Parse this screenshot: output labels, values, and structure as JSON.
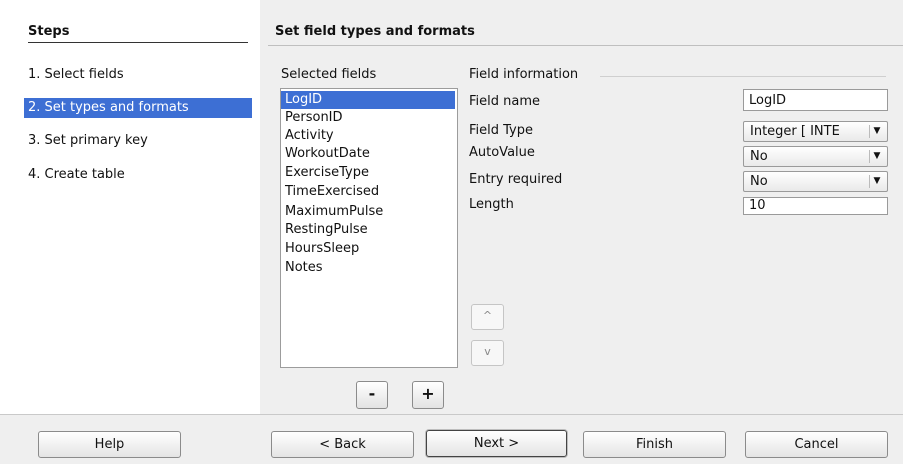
{
  "steps_pane": {
    "title": "Steps",
    "items": [
      {
        "label": "1. Select fields",
        "active": false
      },
      {
        "label": "2. Set types and formats",
        "active": true
      },
      {
        "label": "3. Set primary key",
        "active": false
      },
      {
        "label": "4. Create table",
        "active": false
      }
    ]
  },
  "page": {
    "title": "Set field types and formats"
  },
  "selected_fields": {
    "label": "Selected fields",
    "items": [
      "LogID",
      "PersonID",
      "Activity",
      "WorkoutDate",
      "ExerciseType",
      "TimeExercised",
      "MaximumPulse",
      "RestingPulse",
      "HoursSleep",
      "Notes"
    ],
    "selected": "LogID",
    "remove_label": "-",
    "add_label": "+"
  },
  "field_information": {
    "label": "Field information",
    "field_name": {
      "label": "Field name",
      "value": "LogID"
    },
    "field_type": {
      "label": "Field Type",
      "value": "Integer [ INTE"
    },
    "auto_value": {
      "label": "AutoValue",
      "value": "No"
    },
    "entry_required": {
      "label": "Entry required",
      "value": "No"
    },
    "length": {
      "label": "Length",
      "value": "10"
    },
    "move_up_icon": "chevron-up-icon",
    "move_down_icon": "chevron-down-icon",
    "move_up_glyph": "^",
    "move_down_glyph": "v"
  },
  "footer": {
    "help": "Help",
    "back": "< Back",
    "next": "Next >",
    "finish": "Finish",
    "cancel": "Cancel"
  },
  "colors": {
    "selection": "#3d6fd4"
  }
}
